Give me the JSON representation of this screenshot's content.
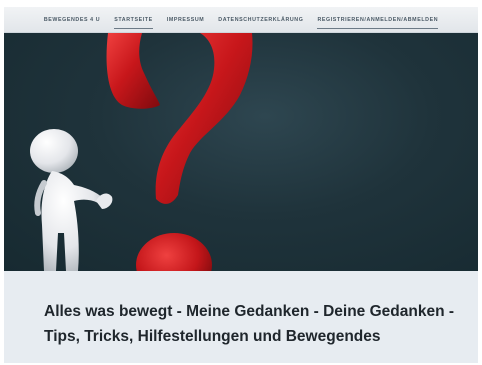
{
  "nav": {
    "items": [
      {
        "label": "BEWEGENDES 4 U"
      },
      {
        "label": "STARTSEITE"
      },
      {
        "label": "IMPRESSUM"
      },
      {
        "label": "DATENSCHUTZERKLÄRUNG"
      },
      {
        "label": "REGISTRIEREN/ANMELDEN/ABMELDEN"
      }
    ]
  },
  "hero": {
    "image": "3d-figure-with-red-question-mark",
    "colors": {
      "background": "#1f333b",
      "question_mark": "#c8171b",
      "figure": "#e8e8ea"
    }
  },
  "main": {
    "headline": "Alles was bewegt - Meine Gedanken - Deine Gedanken - Tips, Tricks, Hilfestellungen und Bewegendes"
  }
}
